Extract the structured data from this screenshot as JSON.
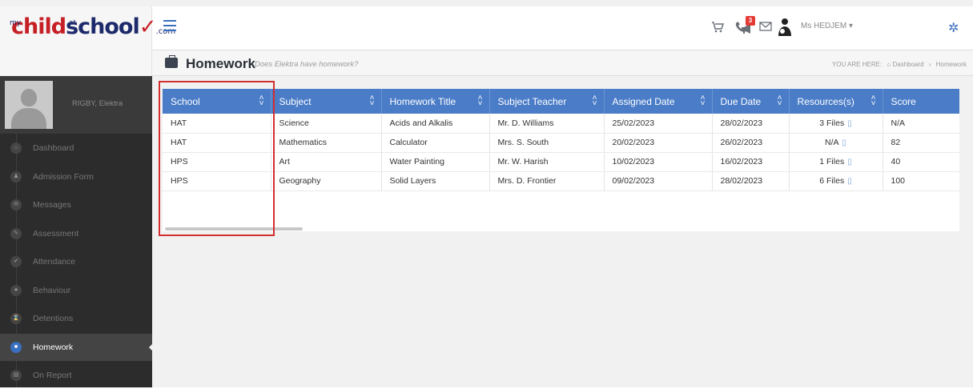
{
  "app": {
    "logo": {
      "my": "my",
      "ch": "ch",
      "ild": "ild",
      "at": "at",
      "school": "school",
      "com": ".com"
    }
  },
  "header": {
    "user_name": "Ms HEDJEM ▾",
    "notification_count": "3",
    "icons": [
      "menu-icon",
      "cart-icon",
      "phone-icon",
      "mail-icon",
      "megaphone-icon",
      "user-avatar-icon",
      "gear-icon"
    ]
  },
  "subheader": {
    "title": "Homework",
    "subtitle": "Does Elektra have homework?",
    "breadcrumb": {
      "prefix": "YOU ARE HERE:",
      "home": "⌂ Dashboard",
      "sep": "›",
      "current": "Homework"
    }
  },
  "sidebar": {
    "profile_name": "RIGBY, Elektra",
    "items": [
      {
        "label": "Dashboard",
        "icon": "⌂"
      },
      {
        "label": "Admission Form",
        "icon": "♟"
      },
      {
        "label": "Messages",
        "icon": "✉"
      },
      {
        "label": "Assessment",
        "icon": "✎"
      },
      {
        "label": "Attendance",
        "icon": "✔"
      },
      {
        "label": "Behaviour",
        "icon": "★"
      },
      {
        "label": "Detentions",
        "icon": "⌛"
      },
      {
        "label": "Homework",
        "icon": "■"
      },
      {
        "label": "On Report",
        "icon": "▤"
      }
    ],
    "active_index": 7
  },
  "table": {
    "columns": [
      "School",
      "Subject",
      "Homework Title",
      "Subject Teacher",
      "Assigned Date",
      "Due Date",
      "Resources(s)",
      "Score"
    ],
    "rows": [
      [
        "HAT",
        "Science",
        "Acids and Alkalis",
        "Mr. D. Williams",
        "25/02/2023",
        "28/02/2023",
        "3 Files",
        "N/A"
      ],
      [
        "HAT",
        "Mathematics",
        "Calculator",
        "Mrs. S. South",
        "20/02/2023",
        "26/02/2023",
        "N/A",
        "82"
      ],
      [
        "HPS",
        "Art",
        "Water Painting",
        "Mr. W. Harish",
        "10/02/2023",
        "16/02/2023",
        "1 Files",
        "40"
      ],
      [
        "HPS",
        "Geography",
        "Solid Layers",
        "Mrs. D. Frontier",
        "09/02/2023",
        "28/02/2023",
        "6 Files",
        "100"
      ]
    ]
  },
  "colors": {
    "accent": "#4a7cc7",
    "highlight": "#d32f2f",
    "sidebar": "#2c2c2c"
  }
}
